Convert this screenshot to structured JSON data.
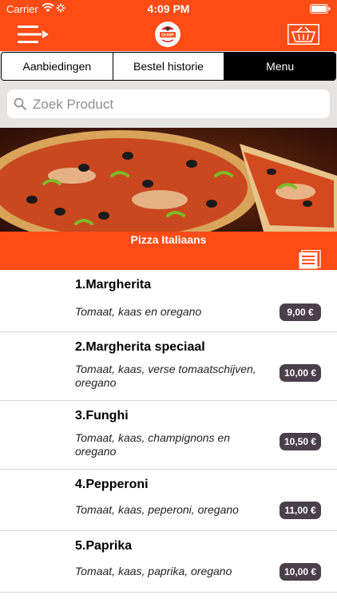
{
  "status_bar": {
    "carrier": "Carrier",
    "time": "4:09 PM"
  },
  "logo": {
    "text": "DURP"
  },
  "tabs": [
    {
      "label": "Aanbiedingen"
    },
    {
      "label": "Bestel historie"
    },
    {
      "label": "Menu"
    }
  ],
  "active_tab": "Menu",
  "search": {
    "placeholder": "Zoek Product",
    "value": ""
  },
  "category": {
    "title": "Pizza Italiaans"
  },
  "products": [
    {
      "name": "1.Margherita",
      "description": "Tomaat, kaas en oregano",
      "price": "9,00 €"
    },
    {
      "name": "2.Margherita speciaal",
      "description": "Tomaat, kaas, verse tomaatschijven, oregano",
      "price": "10,00 €"
    },
    {
      "name": "3.Funghi",
      "description": "Tomaat, kaas, champignons en oregano",
      "price": "10,50 €"
    },
    {
      "name": "4.Pepperoni",
      "description": "Tomaat, kaas, peperoni, oregano",
      "price": "11,00 €"
    },
    {
      "name": "5.Paprika",
      "description": "Tomaat, kaas, paprika, oregano",
      "price": "10,00 €"
    }
  ],
  "colors": {
    "accent": "#ff4b14",
    "badge": "#4a3f4a",
    "tabs_bg": "#e6e3e1"
  },
  "icons": {
    "menu": "hamburger-arrow-icon",
    "basket": "basket-icon",
    "search": "search-icon",
    "list": "list-icon",
    "wifi": "wifi-icon",
    "battery": "battery-icon"
  }
}
